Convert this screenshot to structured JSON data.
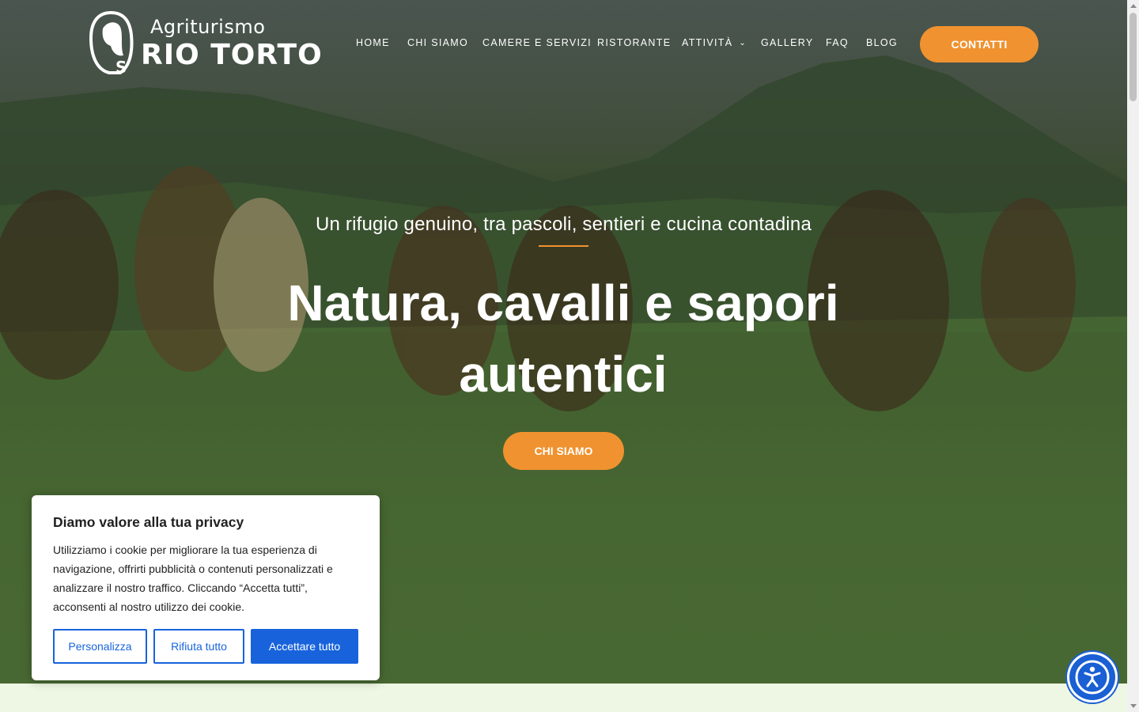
{
  "brand": {
    "logo_top": "Agriturismo",
    "logo_main": "RIO TORTO"
  },
  "nav": {
    "items": [
      {
        "label": "HOME"
      },
      {
        "label": "CHI SIAMO"
      },
      {
        "label": "CAMERE E SERVIZI"
      },
      {
        "label": "RISTORANTE"
      },
      {
        "label": "ATTIVITÀ",
        "has_dropdown": true,
        "icon": "chevron-down-icon"
      },
      {
        "label": "GALLERY"
      },
      {
        "label": "FAQ"
      },
      {
        "label": "BLOG"
      }
    ],
    "cta_label": "CONTATTI"
  },
  "hero": {
    "tagline": "Un rifugio genuino, tra pascoli, sentieri e cucina contadina",
    "headline": "Natura, cavalli e sapori autentici",
    "button_label": "CHI SIAMO"
  },
  "cookie": {
    "title": "Diamo valore alla tua privacy",
    "text": "Utilizziamo i cookie per migliorare la tua esperienza di navigazione, offrirti pubblicità o contenuti personalizzati e analizzare il nostro traffico. Cliccando “Accetta tutti”, acconsenti al nostro utilizzo dei cookie.",
    "customize_label": "Personalizza",
    "reject_label": "Rifiuta tutto",
    "accept_label": "Accettare tutto"
  },
  "accessibility": {
    "icon": "accessibility-icon"
  },
  "colors": {
    "accent": "#f0922f",
    "cookie_blue": "#1863dc",
    "a11y_blue": "#1a5fd3",
    "band": "#eef7e3"
  }
}
